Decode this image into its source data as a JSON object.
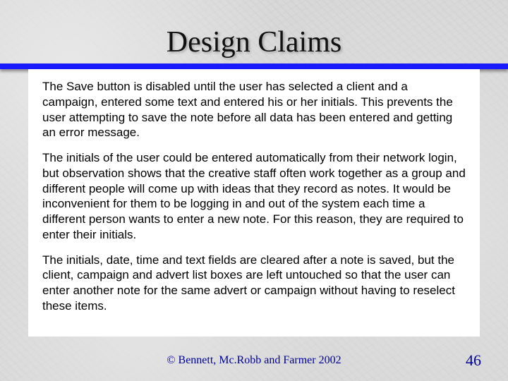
{
  "title": "Design Claims",
  "paragraphs": [
    "The Save button is disabled until the user has selected a client and a campaign, entered some text and entered his or her initials.  This prevents the user attempting to save the note before all data has been entered and getting an error message.",
    "The initials of the user could be entered automatically from their network login, but observation shows that the creative staff often work together as a group and different people will come up with ideas that they record as notes.   It would be inconvenient for them to be logging in and out of the system each time a different person wants to enter a new note.  For this reason, they are required to enter their initials.",
    "The initials, date, time and text fields are cleared after a note is saved, but the client, campaign and advert list boxes are left untouched so that the user can enter another note for the same advert or campaign without having to reselect these items."
  ],
  "footer": "©  Bennett, Mc.Robb and Farmer 2002",
  "page_number": "46"
}
